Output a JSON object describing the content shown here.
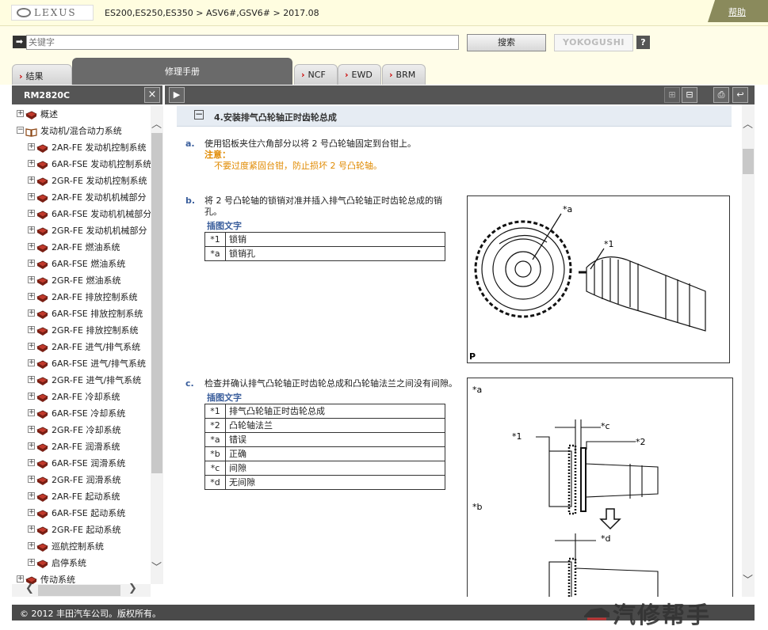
{
  "header": {
    "logo_text": "LEXUS",
    "breadcrumb": "ES200,ES250,ES350 > ASV6#,GSV6# > 2017.08",
    "help_label": "帮助"
  },
  "search": {
    "placeholder": "关键字",
    "search_button": "搜索",
    "yokogushi_button": "YOKOGUSHI",
    "question_label": "?"
  },
  "tabs": [
    {
      "label": "结果"
    },
    {
      "label": "修理手册"
    },
    {
      "label": "NCF"
    },
    {
      "label": "EWD"
    },
    {
      "label": "BRM"
    }
  ],
  "left_panel": {
    "title": "RM2820C",
    "close_label": "×",
    "tree": [
      {
        "label": "概述",
        "level": 0,
        "toggle": "+"
      },
      {
        "label": "发动机/混合动力系统",
        "level": 0,
        "toggle": "−"
      },
      {
        "label": "2AR-FE 发动机控制系统",
        "level": 1,
        "toggle": "+"
      },
      {
        "label": "6AR-FSE 发动机控制系统",
        "level": 1,
        "toggle": "+"
      },
      {
        "label": "2GR-FE 发动机控制系统",
        "level": 1,
        "toggle": "+"
      },
      {
        "label": "2AR-FE 发动机机械部分",
        "level": 1,
        "toggle": "+"
      },
      {
        "label": "6AR-FSE 发动机机械部分",
        "level": 1,
        "toggle": "+"
      },
      {
        "label": "2GR-FE 发动机机械部分",
        "level": 1,
        "toggle": "+"
      },
      {
        "label": "2AR-FE 燃油系统",
        "level": 1,
        "toggle": "+"
      },
      {
        "label": "6AR-FSE 燃油系统",
        "level": 1,
        "toggle": "+"
      },
      {
        "label": "2GR-FE 燃油系统",
        "level": 1,
        "toggle": "+"
      },
      {
        "label": "2AR-FE 排放控制系统",
        "level": 1,
        "toggle": "+"
      },
      {
        "label": "6AR-FSE 排放控制系统",
        "level": 1,
        "toggle": "+"
      },
      {
        "label": "2GR-FE 排放控制系统",
        "level": 1,
        "toggle": "+"
      },
      {
        "label": "2AR-FE 进气/排气系统",
        "level": 1,
        "toggle": "+"
      },
      {
        "label": "6AR-FSE 进气/排气系统",
        "level": 1,
        "toggle": "+"
      },
      {
        "label": "2GR-FE 进气/排气系统",
        "level": 1,
        "toggle": "+"
      },
      {
        "label": "2AR-FE 冷却系统",
        "level": 1,
        "toggle": "+"
      },
      {
        "label": "6AR-FSE 冷却系统",
        "level": 1,
        "toggle": "+"
      },
      {
        "label": "2GR-FE 冷却系统",
        "level": 1,
        "toggle": "+"
      },
      {
        "label": "2AR-FE 润滑系统",
        "level": 1,
        "toggle": "+"
      },
      {
        "label": "6AR-FSE 润滑系统",
        "level": 1,
        "toggle": "+"
      },
      {
        "label": "2GR-FE 润滑系统",
        "level": 1,
        "toggle": "+"
      },
      {
        "label": "2AR-FE 起动系统",
        "level": 1,
        "toggle": "+"
      },
      {
        "label": "6AR-FSE 起动系统",
        "level": 1,
        "toggle": "+"
      },
      {
        "label": "2GR-FE 起动系统",
        "level": 1,
        "toggle": "+"
      },
      {
        "label": "巡航控制系统",
        "level": 1,
        "toggle": "+"
      },
      {
        "label": "启停系统",
        "level": 1,
        "toggle": "+"
      },
      {
        "label": "传动系统",
        "level": 0,
        "toggle": "+"
      }
    ]
  },
  "content": {
    "section_title": "4.安装排气凸轮轴正时齿轮总成",
    "step_a": {
      "letter": "a.",
      "text": "使用铝板夹住六角部分以将 2 号凸轮轴固定到台钳上。",
      "note_label": "注意：",
      "note_text": "不要过度紧固台钳，防止损坏 2 号凸轮轴。"
    },
    "step_b": {
      "letter": "b.",
      "text_line1": "将 2 号凸轮轴的锁销对准并插入排气凸轮轴正时齿轮总成的销",
      "text_line2": "孔。",
      "caption_title": "插图文字",
      "caption": [
        {
          "key": "*1",
          "value": "锁销"
        },
        {
          "key": "*a",
          "value": "锁销孔"
        }
      ],
      "figure_labels": {
        "a": "*a",
        "one": "*1",
        "p": "P"
      }
    },
    "step_c": {
      "letter": "c.",
      "text": "检查并确认排气凸轮轴正时齿轮总成和凸轮轴法兰之间没有间隙。",
      "caption_title": "插图文字",
      "caption": [
        {
          "key": "*1",
          "value": "排气凸轮轴正时齿轮总成"
        },
        {
          "key": "*2",
          "value": "凸轮轴法兰"
        },
        {
          "key": "*a",
          "value": "错误"
        },
        {
          "key": "*b",
          "value": "正确"
        },
        {
          "key": "*c",
          "value": "间隙"
        },
        {
          "key": "*d",
          "value": "无间隙"
        }
      ],
      "figure_labels": {
        "a": "*a",
        "b": "*b",
        "c": "*c",
        "d": "*d",
        "one": "*1",
        "two": "*2"
      }
    }
  },
  "footer": {
    "copyright": "© 2012 丰田汽车公司。版权所有。",
    "watermark": "汽修帮手"
  },
  "colors": {
    "accent": "#c00000",
    "step_letter": "#3a5e9c",
    "note": "#e08a00",
    "panel_dark": "#555555"
  }
}
